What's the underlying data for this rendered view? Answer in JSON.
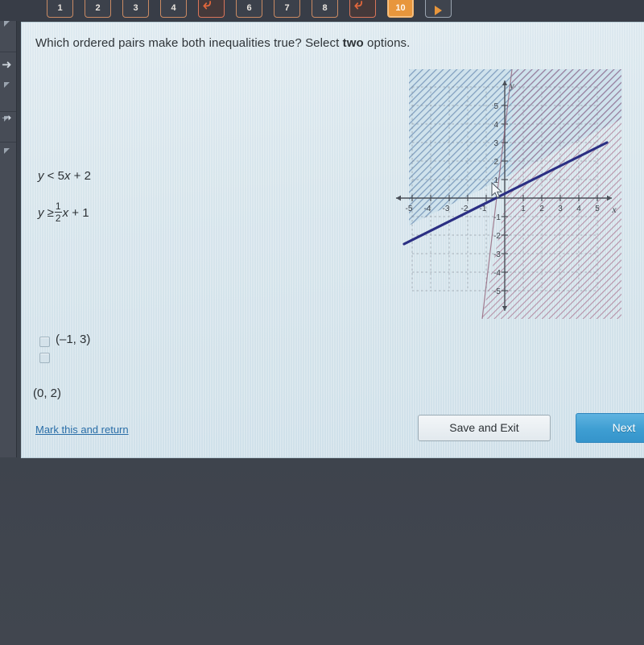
{
  "nav": {
    "items": [
      {
        "label": "1",
        "type": "number"
      },
      {
        "label": "2",
        "type": "number"
      },
      {
        "label": "3",
        "type": "number"
      },
      {
        "label": "4",
        "type": "number"
      },
      {
        "label": "flag",
        "type": "flag"
      },
      {
        "label": "6",
        "type": "number"
      },
      {
        "label": "7",
        "type": "number"
      },
      {
        "label": "8",
        "type": "number"
      },
      {
        "label": "flag",
        "type": "flag"
      },
      {
        "label": "10",
        "type": "current"
      },
      {
        "label": "play",
        "type": "play"
      }
    ],
    "current_label": "10"
  },
  "question": {
    "text_before": "Which ordered pairs make both inequalities true? Select ",
    "emphasis": "two",
    "text_after": " options."
  },
  "inequalities": {
    "first": {
      "lhs": "y",
      "op": "<",
      "rhs_coef": "5",
      "rhs_var": "x",
      "rhs_sign": "+",
      "rhs_const": "2"
    },
    "second": {
      "lhs": "y",
      "op": "≥",
      "num": "1",
      "den": "2",
      "rhs_var": "x",
      "rhs_sign": "+",
      "rhs_const": "1"
    }
  },
  "options": [
    {
      "label": "(–1, 3)",
      "checked": false
    },
    {
      "label": "(0, 2)",
      "checked": false
    }
  ],
  "footer": {
    "mark_link": "Mark this and return",
    "save_label": "Save and Exit",
    "next_label": "Next"
  },
  "chart_data": {
    "type": "line",
    "title": "",
    "xlabel": "x",
    "ylabel": "y",
    "xlim": [
      -6,
      6
    ],
    "ylim": [
      -6,
      6
    ],
    "xticks": [
      "-5",
      "-4",
      "-3",
      "-2",
      "-1",
      "1",
      "2",
      "3",
      "4",
      "5"
    ],
    "yticks": [
      "5",
      "4",
      "3",
      "2",
      "1",
      "-1",
      "-2",
      "-3",
      "-4",
      "-5"
    ],
    "grid": true,
    "legend": "none",
    "series": [
      {
        "name": "y = 1/2 x + 1",
        "style": "solid",
        "color": "#2b2f83",
        "slope": 0.5,
        "intercept": 1,
        "shade": "above",
        "shade_color": "#6f8fb5"
      },
      {
        "name": "y = 5x + 2",
        "style": "solid",
        "color": "#8e5a72",
        "slope": 5,
        "intercept": 2,
        "shade": "right",
        "shade_color": "#9c5f7a"
      }
    ],
    "axis_color": "#4a4f58"
  },
  "colors": {
    "accent_orange": "#e8963c",
    "next_blue": "#3e9ed2",
    "link_blue": "#2a6ea8",
    "card_bg": "#d7e5ec",
    "desktop_bg": "#3b414a"
  }
}
